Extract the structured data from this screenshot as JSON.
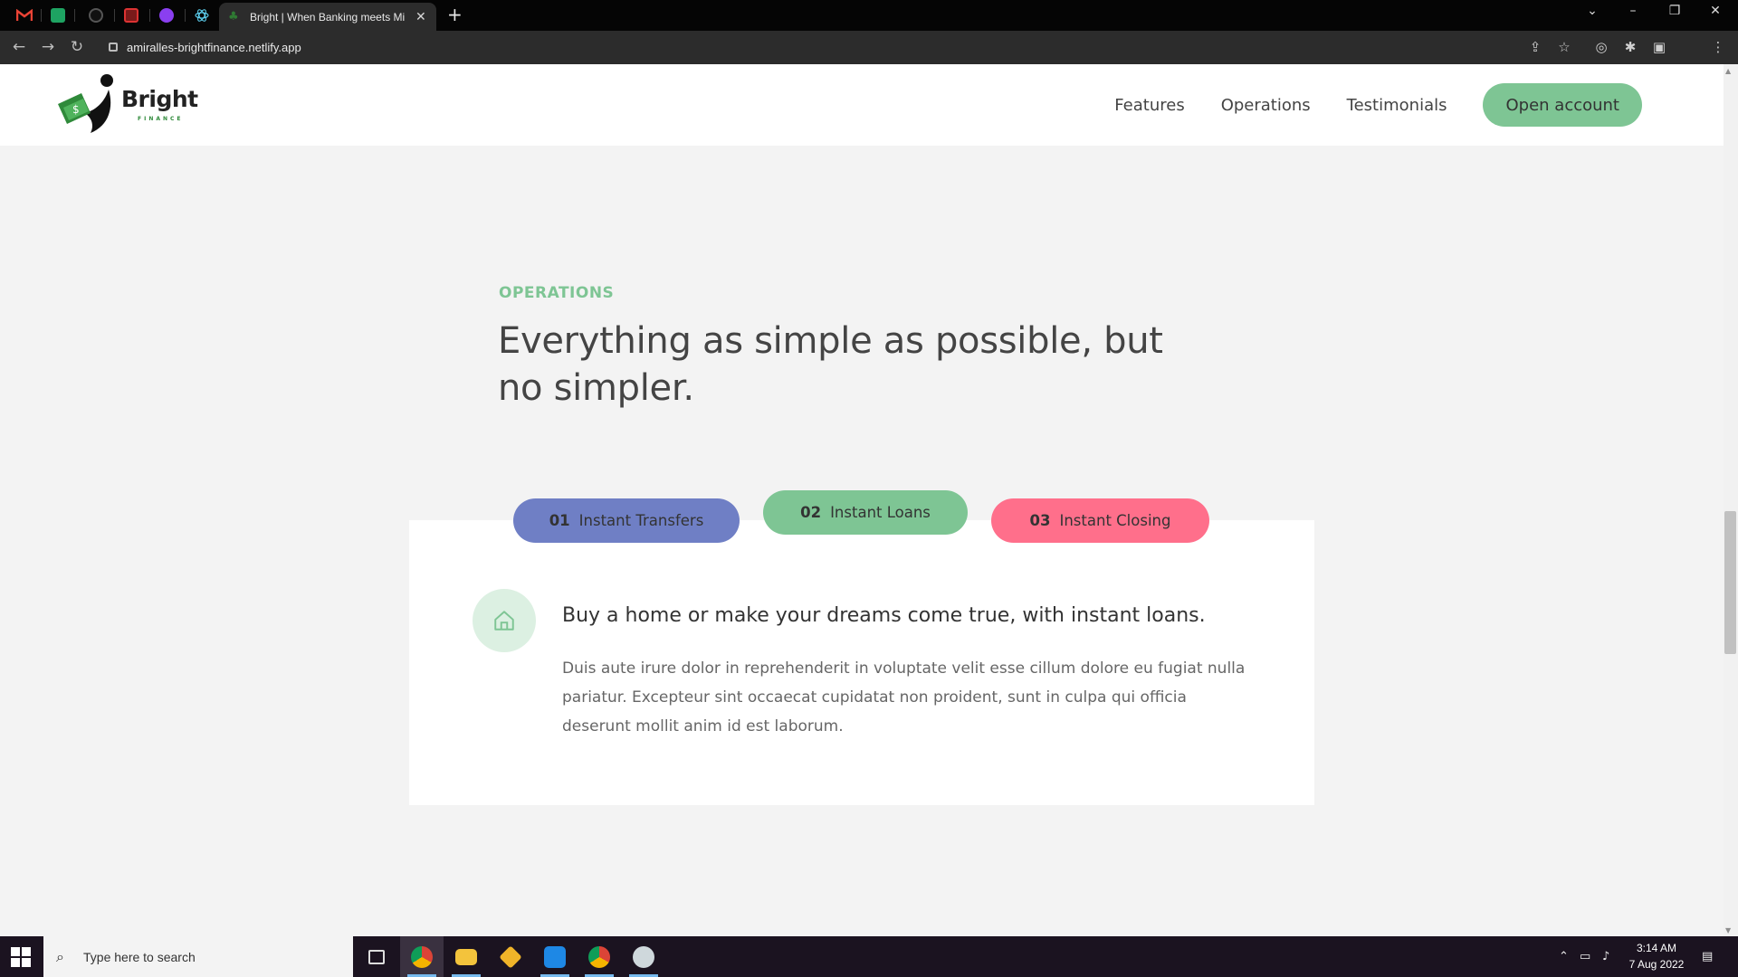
{
  "browser": {
    "active_tab_title": "Bright | When Banking meets Mi",
    "url": "amiralles-brightfinance.netlify.app",
    "new_tab_symbol": "+",
    "close_symbol": "✕"
  },
  "site": {
    "logo_word": "Bright",
    "logo_sub": "FINANCE",
    "nav": [
      "Features",
      "Operations",
      "Testimonials"
    ],
    "cta": "Open account"
  },
  "section": {
    "eyebrow": "OPERATIONS",
    "heading": "Everything as simple as possible, but no simpler."
  },
  "operations": {
    "tabs": [
      {
        "num": "01",
        "label": "Instant Transfers",
        "color": "#6f7fc5"
      },
      {
        "num": "02",
        "label": "Instant Loans",
        "color": "#7ec594"
      },
      {
        "num": "03",
        "label": "Instant Closing",
        "color": "#ff6f8b"
      }
    ],
    "active_index": 1,
    "content_title": "Buy a home or make your dreams come true, with instant loans.",
    "content_text": "Duis aute irure dolor in reprehenderit in voluptate velit esse cillum dolore eu fugiat nulla pariatur. Excepteur sint occaecat cupidatat non proident, sunt in culpa qui officia deserunt mollit anim id est laborum.",
    "icon": "home-icon"
  },
  "taskbar": {
    "search_placeholder": "Type here to search",
    "time": "3:14 AM",
    "date": "7 Aug 2022"
  },
  "colors": {
    "accent_green": "#7ec594",
    "accent_blue": "#6f7fc5",
    "accent_pink": "#ff6f8b"
  }
}
